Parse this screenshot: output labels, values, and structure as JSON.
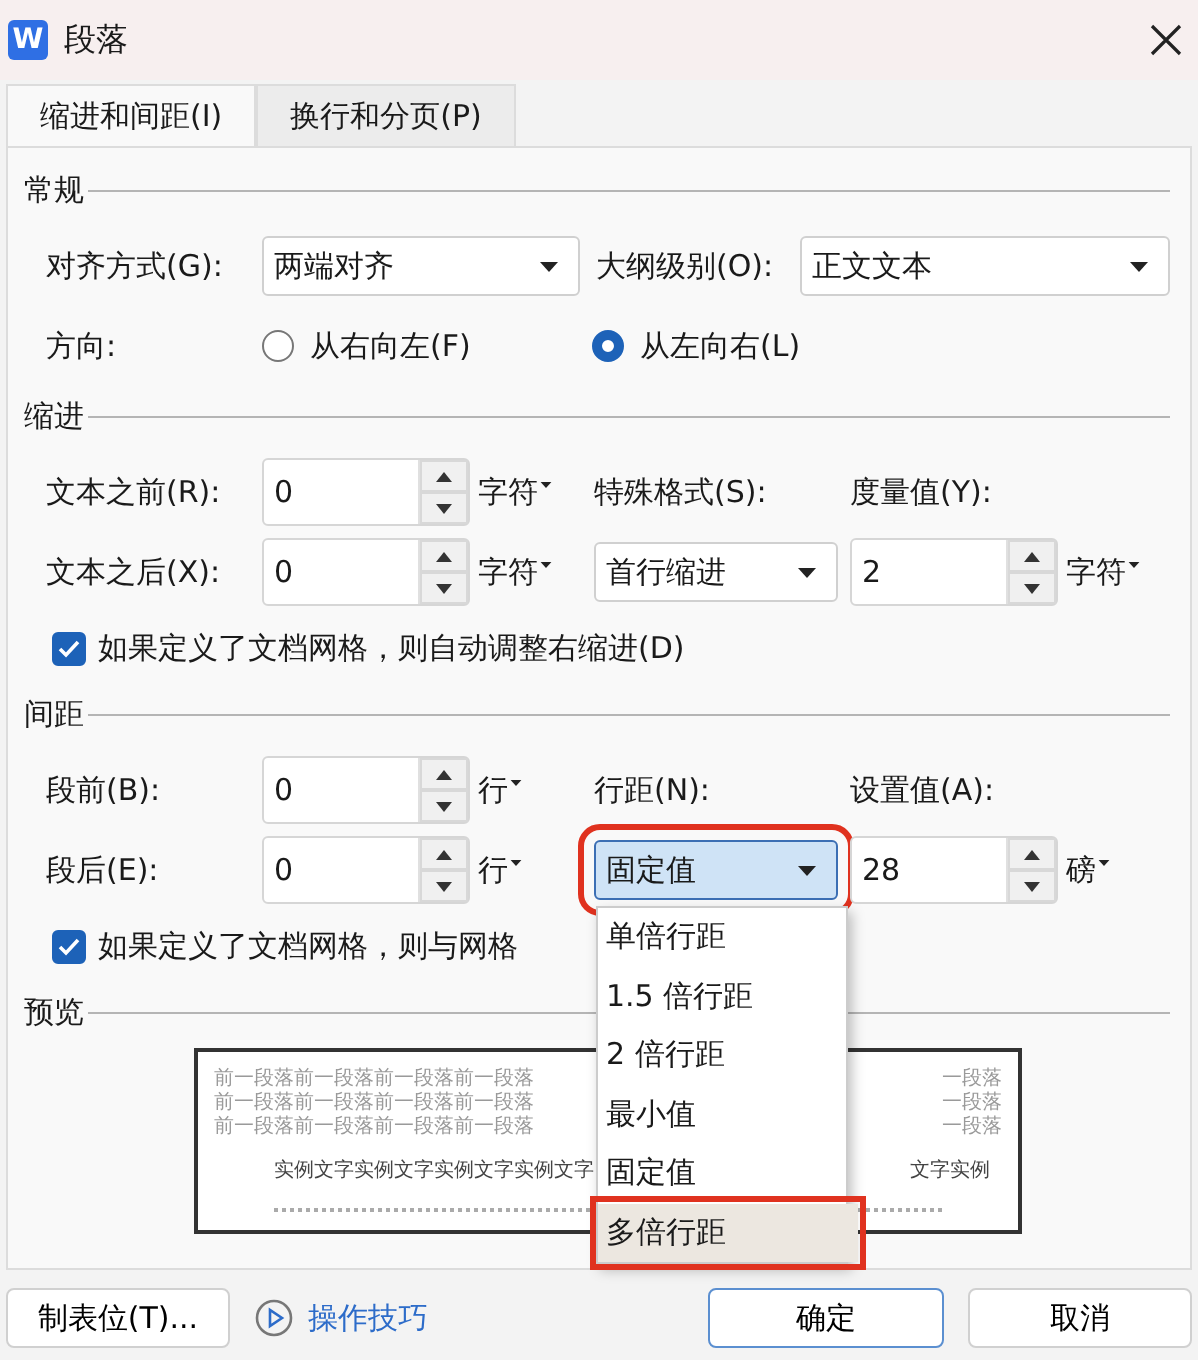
{
  "window": {
    "title": "段落",
    "app_icon_letter": "W"
  },
  "tabs": [
    {
      "label": "缩进和间距(I)",
      "selected": true
    },
    {
      "label": "换行和分页(P)",
      "selected": false
    }
  ],
  "general": {
    "title": "常规",
    "alignment": {
      "label": "对齐方式(G):",
      "value": "两端对齐"
    },
    "outline_level": {
      "label": "大纲级别(O):",
      "value": "正文文本"
    },
    "direction": {
      "label": "方向:",
      "options": [
        {
          "label": "从右向左(F)",
          "selected": false
        },
        {
          "label": "从左向右(L)",
          "selected": true
        }
      ]
    }
  },
  "indent": {
    "title": "缩进",
    "before": {
      "label": "文本之前(R):",
      "value": "0",
      "unit": "字符"
    },
    "after": {
      "label": "文本之后(X):",
      "value": "0",
      "unit": "字符"
    },
    "special": {
      "label": "特殊格式(S):",
      "value": "首行缩进"
    },
    "measure": {
      "label": "度量值(Y):",
      "value": "2",
      "unit": "字符"
    },
    "grid_option": {
      "label": "如果定义了文档网格，则自动调整右缩进(D)",
      "checked": true
    }
  },
  "spacing": {
    "title": "间距",
    "before": {
      "label": "段前(B):",
      "value": "0",
      "unit": "行"
    },
    "after": {
      "label": "段后(E):",
      "value": "0",
      "unit": "行"
    },
    "line_spacing": {
      "label": "行距(N):",
      "value": "固定值",
      "annotated": true,
      "expanded": true,
      "options": [
        {
          "label": "单倍行距",
          "highlighted": false,
          "annotated": false
        },
        {
          "label": "1.5 倍行距",
          "highlighted": false,
          "annotated": false
        },
        {
          "label": "2 倍行距",
          "highlighted": false,
          "annotated": false
        },
        {
          "label": "最小值",
          "highlighted": false,
          "annotated": false
        },
        {
          "label": "固定值",
          "highlighted": false,
          "annotated": false
        },
        {
          "label": "多倍行距",
          "highlighted": true,
          "annotated": true
        }
      ]
    },
    "set_value": {
      "label": "设置值(A):",
      "value": "28",
      "unit": "磅"
    },
    "grid_option": {
      "label": "如果定义了文档网格，则与网格",
      "checked": true
    }
  },
  "preview": {
    "title": "预览",
    "lines": [
      {
        "kind": "previous",
        "left": "前一段落前一段落前一段落前一段落",
        "right": "一段落"
      },
      {
        "kind": "previous",
        "left": "前一段落前一段落前一段落前一段落",
        "right": "一段落"
      },
      {
        "kind": "previous",
        "left": "前一段落前一段落前一段落前一段落",
        "right": "一段落"
      },
      {
        "kind": "sample",
        "left": "实例文字实例文字实例文字实例文字",
        "right": "文字实例"
      }
    ]
  },
  "buttons": [
    {
      "label": "制表位(T)...",
      "kind": "button"
    },
    {
      "label": "操作技巧",
      "kind": "link"
    },
    {
      "label": "确定",
      "kind": "primary"
    },
    {
      "label": "取消",
      "kind": "button"
    }
  ]
}
